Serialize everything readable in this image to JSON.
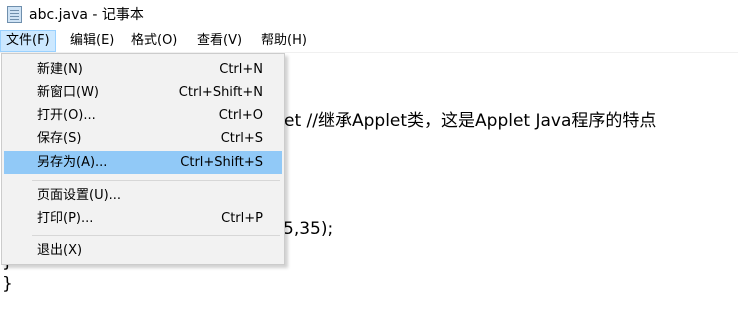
{
  "window": {
    "title": "abc.java - 记事本",
    "icon": "notepad-icon"
  },
  "menubar": {
    "items": [
      {
        "label": "文件(F)",
        "active": true
      },
      {
        "label": "编辑(E)"
      },
      {
        "label": "格式(O)"
      },
      {
        "label": "查看(V)"
      },
      {
        "label": "帮助(H)"
      }
    ]
  },
  "file_menu": {
    "items": [
      {
        "label": "新建(N)",
        "shortcut": "Ctrl+N"
      },
      {
        "label": "新窗口(W)",
        "shortcut": "Ctrl+Shift+N"
      },
      {
        "label": "打开(O)...",
        "shortcut": "Ctrl+O"
      },
      {
        "label": "保存(S)",
        "shortcut": "Ctrl+S"
      },
      {
        "label": "另存为(A)...",
        "shortcut": "Ctrl+Shift+S",
        "highlighted": true
      },
      {
        "label": "页面设置(U)..."
      },
      {
        "label": "打印(P)...",
        "shortcut": "Ctrl+P"
      },
      {
        "label": "退出(X)"
      }
    ]
  },
  "editor": {
    "visible_fragments": [
      "et //继承Applet类，这是Applet Java程序的特点",
      "5,35);",
      "}",
      "}"
    ]
  },
  "colors": {
    "menu_active_bg": "#cce8ff",
    "dropdown_bg": "#f2f2f2",
    "highlight_bg": "#91c9f7"
  }
}
